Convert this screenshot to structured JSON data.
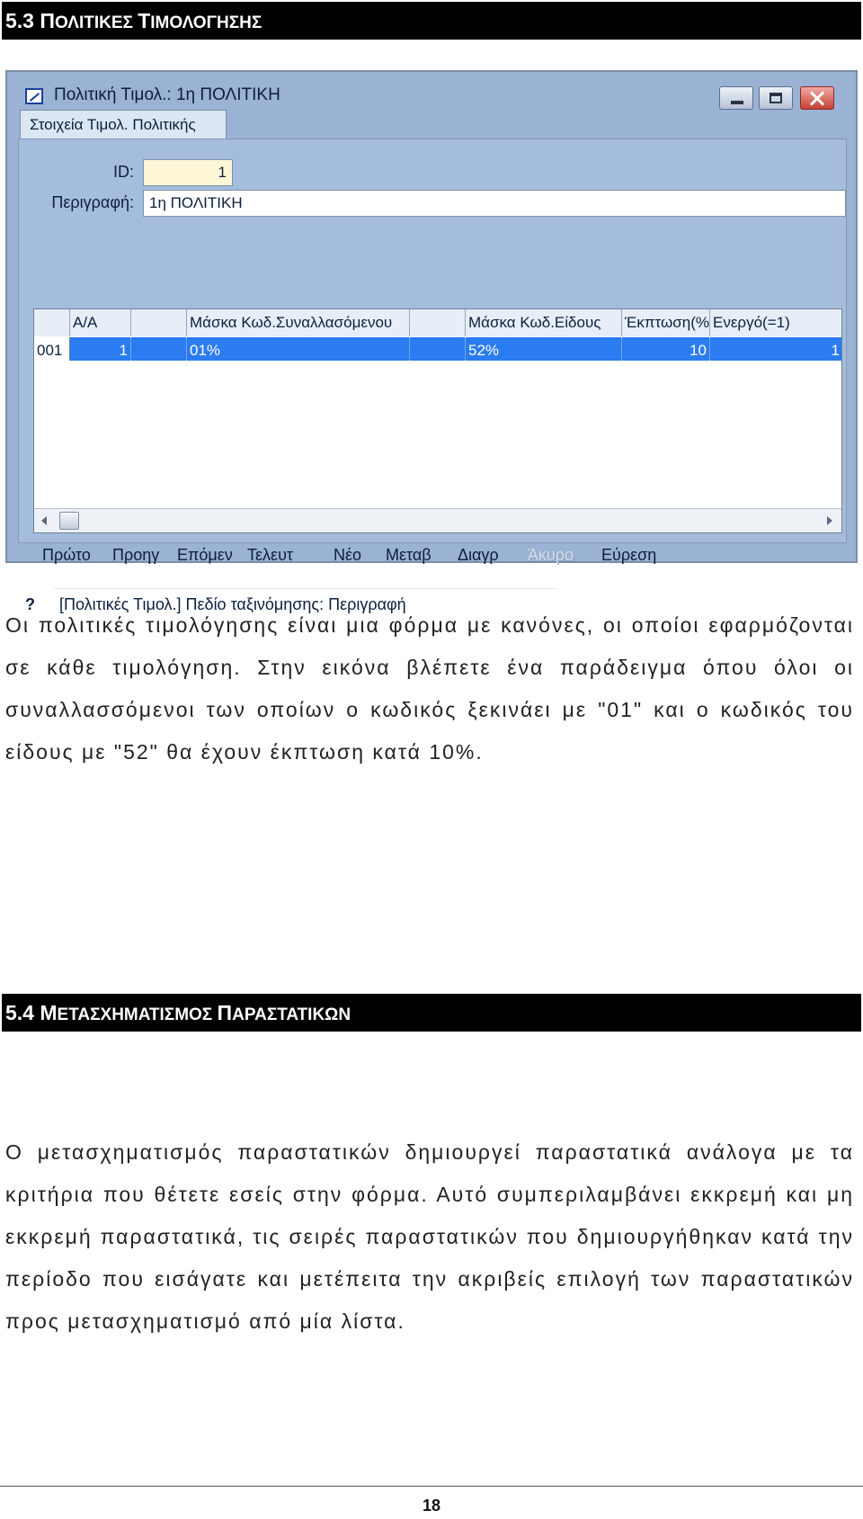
{
  "section1": {
    "number": "5.3",
    "title_first": "Π",
    "title_rest": "ΟΛΙΤΙΚΕΣ ",
    "title_second": "Τ",
    "title_rest2": "ΙΜΟΛΟΓΗΣΗΣ"
  },
  "window": {
    "title": "Πολιτική Τιμολ.: 1η ΠΟΛΙΤΙΚΗ",
    "tab_label": "Στοιχεία Τιμολ. Πολιτικής",
    "id_label": "ID:",
    "id_value": "1",
    "desc_label": "Περιγραφή:",
    "desc_value": "1η ΠΟΛΙΤΙΚΗ",
    "grid": {
      "headers": [
        "",
        "Α/Α",
        "",
        "Μάσκα Κωδ.Συναλλασόμενου",
        "",
        "Μάσκα Κωδ.Είδους",
        "Έκπτωση(%)",
        "Ενεργό(=1)"
      ],
      "row": [
        "001",
        "1",
        "",
        "01%",
        "",
        "52%",
        "10",
        "1"
      ]
    },
    "nav": [
      "Πρώτο",
      "Προηγ",
      "Επόμεν",
      "Τελευτ",
      "Νέο",
      "Μεταβ",
      "Διαγρ",
      "Άκυρο",
      "Εύρεση"
    ],
    "status_help": "?",
    "status_text": "[Πολιτικές Τιμολ.]  Πεδίο ταξινόμησης: Περιγραφή"
  },
  "para1": "Οι πολιτικές τιμολόγησης είναι μια φόρμα με κανόνες, οι οποίοι εφαρμόζονται σε κάθε τιμολόγηση. Στην εικόνα βλέπετε ένα παράδειγμα όπου όλοι οι συναλλασσόμενοι των οποίων ο κωδικός ξεκινάει με \"01\" και ο κωδικός του είδους με \"52\" θα έχουν έκπτωση κατά 10%.",
  "section2": {
    "number": "5.4",
    "title_first": "Μ",
    "title_rest": "ΕΤΑΣΧΗΜΑΤΙΣΜΟΣ ",
    "title_second": "Π",
    "title_rest2": "ΑΡΑΣΤΑΤΙΚΩΝ"
  },
  "para2": "Ο μετασχηματισμός παραστατικών δημιουργεί παραστατικά ανάλογα με τα κριτήρια που θέτετε εσείς στην φόρμα. Αυτό συμπεριλαμβάνει εκκρεμή και μη εκκρεμή παραστατικά, τις σειρές παραστατικών που δημιουργήθηκαν κατά την περίοδο που εισάγατε και μετέπειτα την ακριβείς επιλογή των παραστατικών προς μετασχηματισμό από μία λίστα.",
  "page_number": "18"
}
